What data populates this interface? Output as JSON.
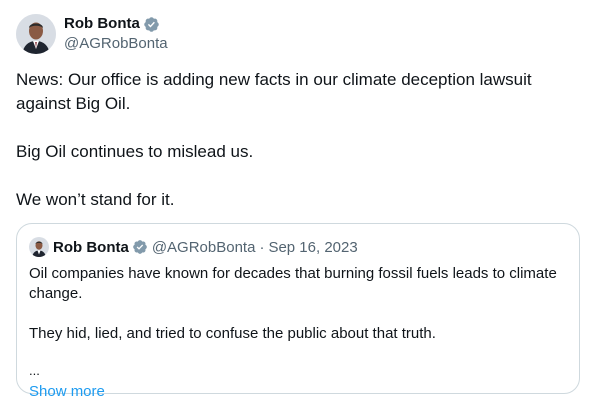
{
  "tweet": {
    "author": {
      "display_name": "Rob Bonta",
      "handle": "@AGRobBonta",
      "verified_icon": "verified-badge-icon"
    },
    "paragraphs": [
      "News: Our office is adding new facts in our climate deception lawsuit against Big Oil.",
      "Big Oil continues to mislead us.",
      "We won’t stand for it."
    ]
  },
  "quote": {
    "author": {
      "display_name": "Rob Bonta",
      "handle": "@AGRobBonta",
      "separator": "·",
      "date": "Sep 16, 2023"
    },
    "paragraphs": [
      "Oil companies have known for decades that burning fossil fuels leads to climate change.",
      "They hid, lied, and tried to confuse the public about that truth."
    ],
    "ellipsis": "...",
    "show_more": "Show more"
  },
  "colors": {
    "text": "#0f1419",
    "secondary": "#536471",
    "link": "#1d9bf0",
    "border": "#cfd9de"
  }
}
